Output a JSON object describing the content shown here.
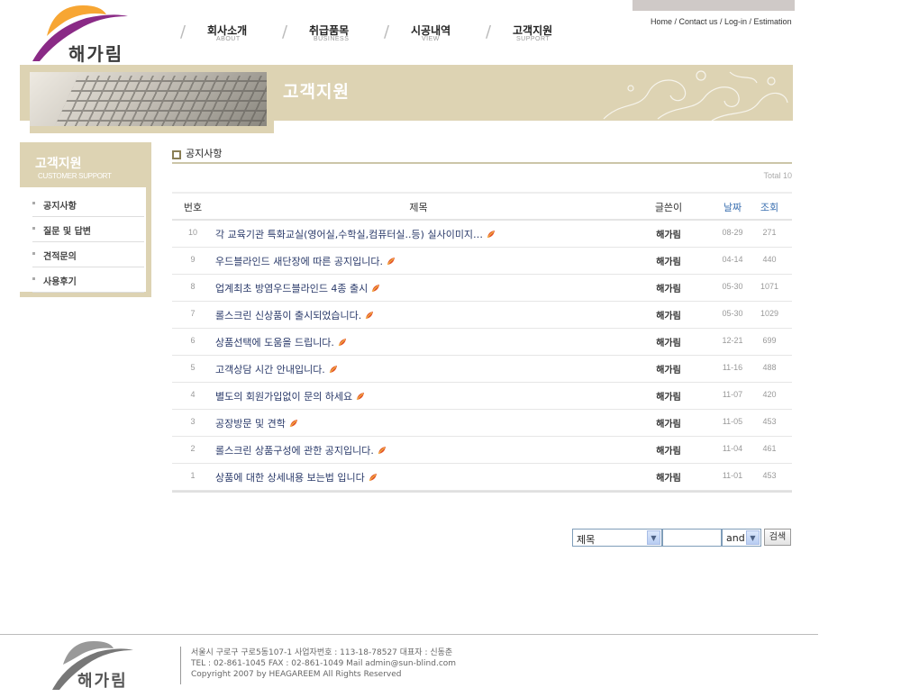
{
  "brand": {
    "name": "해가림"
  },
  "top_links": "Home / Contact us / Log-in / Estimation",
  "nav": [
    {
      "ko": "회사소개",
      "en": "ABOUT"
    },
    {
      "ko": "취급품목",
      "en": "BUSINESS"
    },
    {
      "ko": "시공내역",
      "en": "VIEW"
    },
    {
      "ko": "고객지원",
      "en": "SUPPORT"
    }
  ],
  "banner": {
    "title": "고객지원"
  },
  "sidebar": {
    "title_ko": "고객지원",
    "title_en": "CUSTOMER SUPPORT",
    "items": [
      {
        "label": "공지사항"
      },
      {
        "label": "질문 및 답변"
      },
      {
        "label": "견적문의"
      },
      {
        "label": "사용후기"
      }
    ]
  },
  "board": {
    "section_title": "공지사항",
    "total": "Total 10",
    "headers": {
      "no": "번호",
      "title": "제목",
      "writer": "글쓴이",
      "date": "날짜",
      "views": "조회"
    },
    "rows": [
      {
        "no": "10",
        "title": "각 교육기관 특화교실(영어실,수학실,컴퓨터실..등) 실사이미지…",
        "writer": "해가림",
        "date": "08-29",
        "views": "271"
      },
      {
        "no": "9",
        "title": "우드블라인드 새단장에 따른 공지입니다.",
        "writer": "해가림",
        "date": "04-14",
        "views": "440"
      },
      {
        "no": "8",
        "title": "업계최초 방염우드블라인드 4종 출시",
        "writer": "해가림",
        "date": "05-30",
        "views": "1071"
      },
      {
        "no": "7",
        "title": "롤스크린 신상품이 출시되었습니다.",
        "writer": "해가림",
        "date": "05-30",
        "views": "1029"
      },
      {
        "no": "6",
        "title": "상품선택에 도움을 드립니다.",
        "writer": "해가림",
        "date": "12-21",
        "views": "699"
      },
      {
        "no": "5",
        "title": "고객상담 시간 안내입니다.",
        "writer": "해가림",
        "date": "11-16",
        "views": "488"
      },
      {
        "no": "4",
        "title": "별도의 회원가입없이 문의 하세요",
        "writer": "해가림",
        "date": "11-07",
        "views": "420"
      },
      {
        "no": "3",
        "title": "공장방문 및 견학",
        "writer": "해가림",
        "date": "11-05",
        "views": "453"
      },
      {
        "no": "2",
        "title": "롤스크린 상품구성에 관한 공지입니다.",
        "writer": "해가림",
        "date": "11-04",
        "views": "461"
      },
      {
        "no": "1",
        "title": "상품에 대한 상세내용 보는법 입니다",
        "writer": "해가림",
        "date": "11-01",
        "views": "453"
      }
    ]
  },
  "search": {
    "field_selected": "제목",
    "query": "",
    "operator_selected": "and",
    "button_label": "검색"
  },
  "footer": {
    "brand": "해가림",
    "line1": "서울시 구로구 구로5동107-1  사업자번호 : 113-18-78527  대표자 : 신동춘",
    "line2": "TEL : 02-861-1045  FAX : 02-861-1049   Mail admin@sun-blind.com",
    "line3": "Copyright 2007 by HEAGAREEM All Rights Reserved"
  },
  "colors": {
    "accent_beige": "#ddd3b3",
    "link_navy": "#2a3a6a",
    "logo_orange": "#f7a633",
    "logo_purple": "#8a2a86"
  }
}
